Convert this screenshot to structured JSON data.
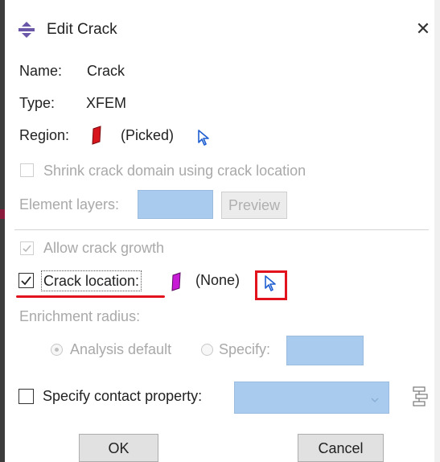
{
  "dialog": {
    "title": "Edit Crack",
    "close_glyph": "✕",
    "title_icon": "crack-icon"
  },
  "name": {
    "label": "Name:",
    "value": "Crack"
  },
  "type": {
    "label": "Type:",
    "value": "XFEM"
  },
  "region": {
    "label": "Region:",
    "value": "(Picked)",
    "icon": "red-region-icon",
    "pick_icon": "select-arrow-icon"
  },
  "shrink": {
    "label": "Shrink crack domain using crack location",
    "checked": false,
    "enabled": false
  },
  "element_layers": {
    "label": "Element layers:",
    "value": "",
    "preview_label": "Preview"
  },
  "allow_growth": {
    "label": "Allow crack growth",
    "checked": true,
    "enabled": false
  },
  "crack_location": {
    "label": "Crack location:",
    "checked": true,
    "value": "(None)",
    "icon": "purple-region-icon",
    "pick_icon": "select-arrow-icon"
  },
  "enrichment": {
    "label": "Enrichment radius:",
    "analysis_default_label": "Analysis default",
    "specify_label": "Specify:",
    "value": ""
  },
  "contact": {
    "label": "Specify contact property:",
    "checked": false,
    "value": "",
    "create_icon": "create-property-icon"
  },
  "buttons": {
    "ok": "OK",
    "cancel": "Cancel"
  },
  "colors": {
    "accent_red": "#e2131c",
    "field_blue": "#a9cbed",
    "region_red": "#d8141c",
    "region_purple": "#c81bd6"
  }
}
